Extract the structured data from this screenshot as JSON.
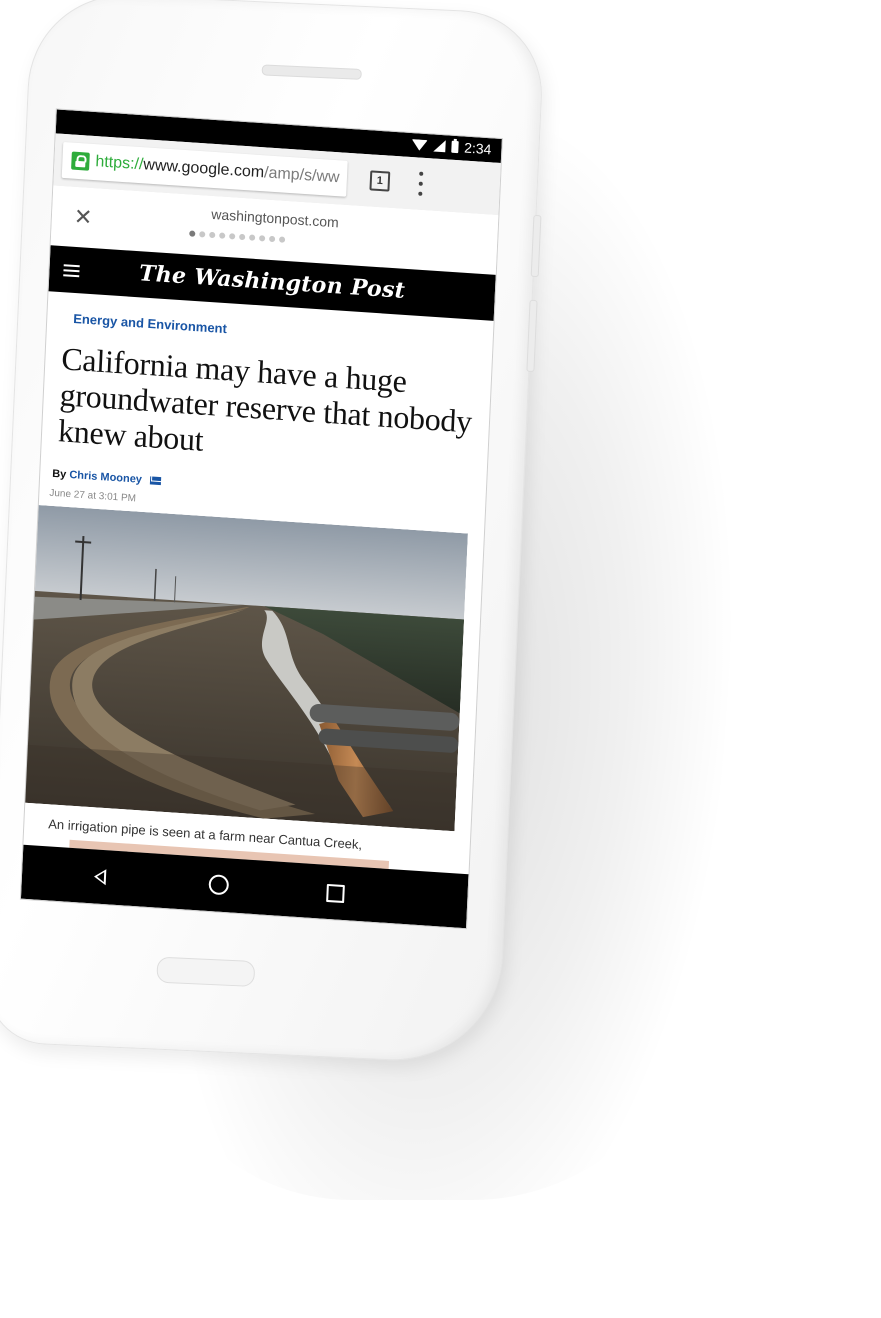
{
  "status_bar": {
    "time": "2:34"
  },
  "browser": {
    "url": {
      "scheme": "https://",
      "host": "www.google.com",
      "path": "/amp/s/ww"
    },
    "tab_count": "1"
  },
  "carousel": {
    "domain": "washingtonpost.com",
    "page_count": 10,
    "active_page": 1
  },
  "publication": {
    "masthead": "The Washington Post"
  },
  "article": {
    "kicker": "Energy and Environment",
    "headline": "California may have a huge groundwater reserve that nobody knew about",
    "byline_prefix": "By",
    "author": "Chris Mooney",
    "date": "June 27 at 3:01 PM",
    "caption": "An irrigation pipe is seen at a farm near Cantua Creek,"
  },
  "colors": {
    "secure_green": "#2eac3b",
    "link_blue": "#1955a5",
    "masthead_bg": "#000000"
  },
  "icons": [
    "lock-icon",
    "tabs-icon",
    "menu-icon",
    "close-icon",
    "hamburger-icon",
    "mail-icon",
    "back-icon",
    "home-icon",
    "recent-apps-icon"
  ]
}
